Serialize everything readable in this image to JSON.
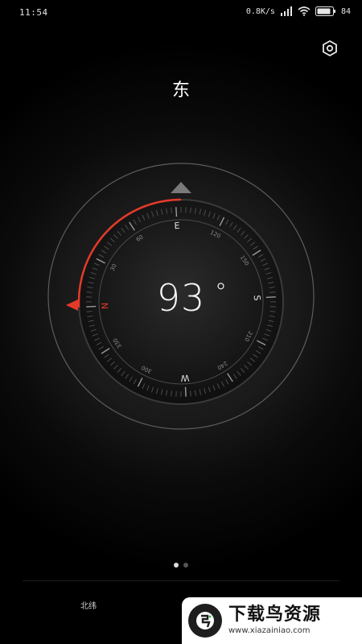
{
  "status_bar": {
    "time": "11:54",
    "speed": "0.8K/s",
    "battery_pct": "84"
  },
  "header": {
    "settings_icon": "gear-hex-icon",
    "direction": "东"
  },
  "compass": {
    "heading": "93",
    "degree_symbol": "°",
    "cardinals": {
      "E": "E",
      "S": "S",
      "W": "W",
      "N": "N"
    },
    "tick_labels": [
      "30",
      "60",
      "120",
      "150",
      "210",
      "240",
      "300",
      "330"
    ],
    "accent_color": "#e53a2a"
  },
  "pager": {
    "pages": 2,
    "active": 0
  },
  "footer": {
    "coord_label": "北纬"
  },
  "watermark": {
    "title": "下载鸟资源",
    "url": "www.xiazainiao.com"
  }
}
